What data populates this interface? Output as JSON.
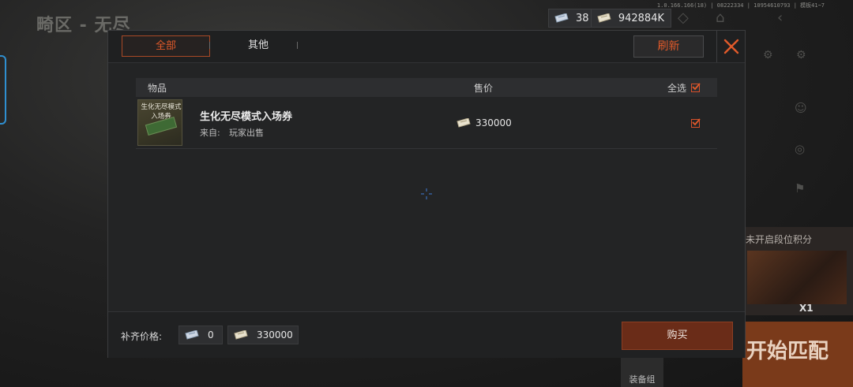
{
  "background": {
    "title": "畸区 - 无尽",
    "version": "1.0.166.166(18) | 08222334 | 10954610793 | 模板41~7",
    "currency_a": "38",
    "currency_b": "942884K",
    "ranked_text": "未开启段位积分",
    "reward_count": "X1",
    "match_button": "开始匹配",
    "loadout_label": "装备组"
  },
  "modal": {
    "tabs": [
      {
        "label": "全部",
        "selected": true
      },
      {
        "label": "其他",
        "selected": false
      }
    ],
    "refresh_label": "刷新",
    "table": {
      "col_item": "物品",
      "col_price": "售价",
      "select_all": "全选",
      "select_all_checked": true
    },
    "items": [
      {
        "thumb_text": "生化无尽模式入场券",
        "name": "生化无尽模式入场券",
        "source_label": "来自:",
        "source": "玩家出售",
        "price": "330000",
        "checked": true
      }
    ],
    "footer": {
      "fill_label": "补齐价格:",
      "fill_silver": "0",
      "fill_gold": "330000",
      "buy_label": "购买"
    }
  },
  "colors": {
    "accent": "#e15a2a",
    "buy_button": "#6a2c18",
    "modal_bg": "#232425"
  },
  "icons": [
    "ticket-silver-icon",
    "ticket-gold-icon",
    "close-icon",
    "checkbox-icon",
    "crosshair-icon"
  ]
}
